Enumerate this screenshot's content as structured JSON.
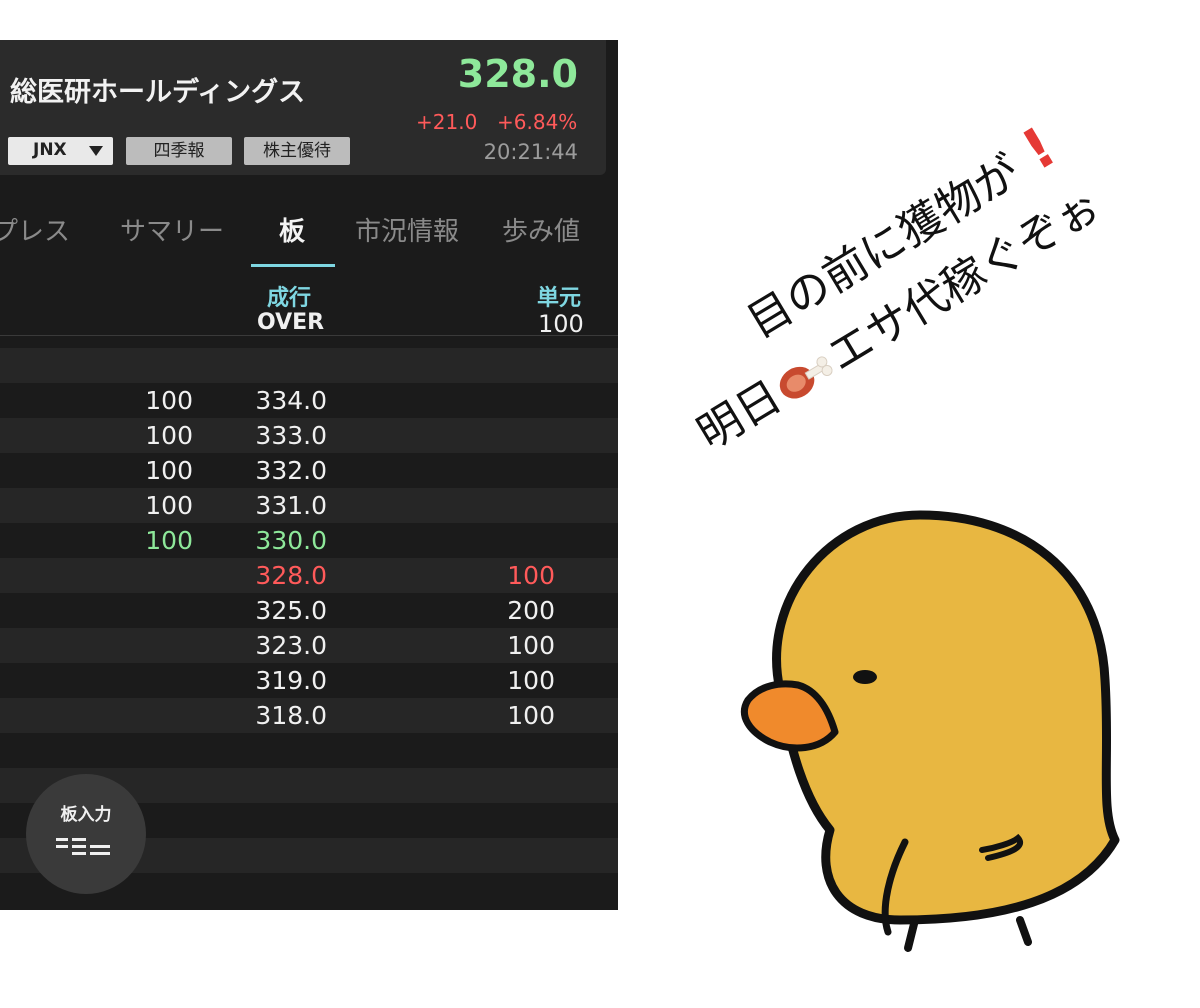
{
  "stock": {
    "name": "総医研ホールディングス",
    "price": "328.0",
    "change": "+21.0",
    "change_pct": "+6.84%",
    "time": "20:21:44",
    "market": "JNX",
    "buttons": [
      "四季報",
      "株主優待"
    ]
  },
  "tabs": [
    "プレス",
    "サマリー",
    "板",
    "市況情報",
    "歩み値"
  ],
  "active_tab": "板",
  "board": {
    "center_header": {
      "label": "成行",
      "value": "OVER"
    },
    "right_header": {
      "label": "単元",
      "value": "100"
    },
    "rows": [
      {
        "sell": "100",
        "price": "334.0",
        "buy": ""
      },
      {
        "sell": "100",
        "price": "333.0",
        "buy": ""
      },
      {
        "sell": "100",
        "price": "332.0",
        "buy": ""
      },
      {
        "sell": "100",
        "price": "331.0",
        "buy": ""
      },
      {
        "sell": "100",
        "price": "330.0",
        "buy": ""
      },
      {
        "sell": "",
        "price": "328.0",
        "buy": "100"
      },
      {
        "sell": "",
        "price": "325.0",
        "buy": "200"
      },
      {
        "sell": "",
        "price": "323.0",
        "buy": "100"
      },
      {
        "sell": "",
        "price": "319.0",
        "buy": "100"
      },
      {
        "sell": "",
        "price": "318.0",
        "buy": "100"
      }
    ],
    "input_button": "板入力"
  },
  "caption": {
    "line1": "目の前に獲物が",
    "line2_before": "明日",
    "line2_after": "エサ代稼ぐぞぉ"
  },
  "colors": {
    "price_up": "#8ee89a",
    "change_red": "#ff5a5a",
    "accent": "#7fd7e2",
    "panel_bg": "#1b1b1b"
  },
  "icons": [
    "exclamation-icon",
    "meat-emoji-icon",
    "chick-illustration",
    "board-input-icon"
  ]
}
